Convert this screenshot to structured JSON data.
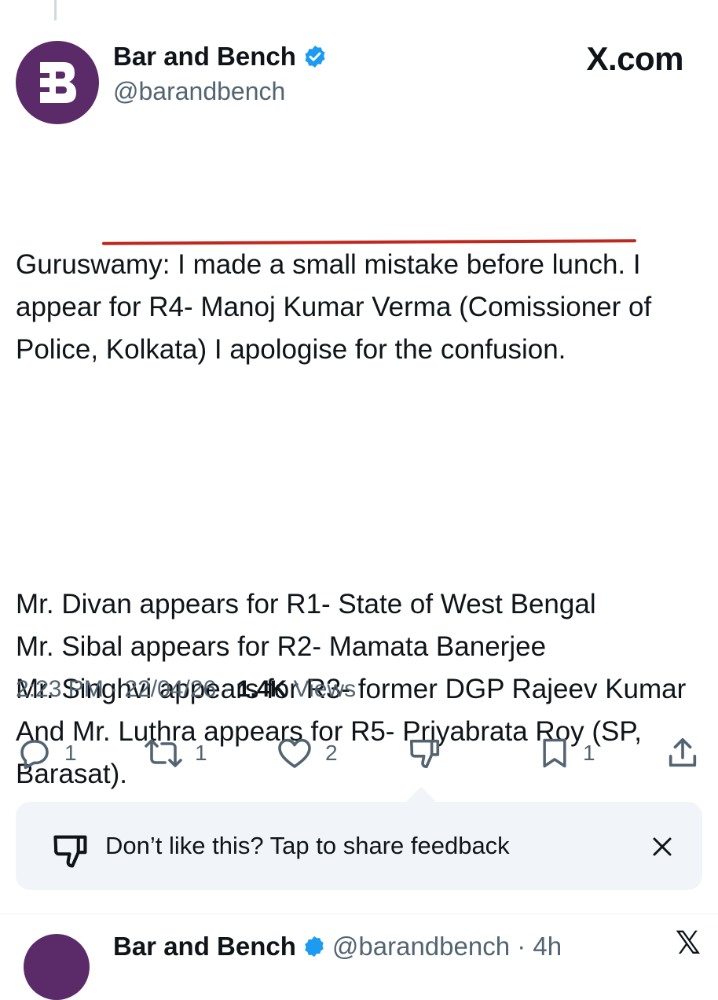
{
  "post": {
    "author_name": "Bar and Bench",
    "author_handle": "@barandbench",
    "avatar_letter": "B",
    "source_label": "X.com",
    "body_paragraphs": [
      "Guruswamy: I made a small mistake before lunch. I appear for R4- Manoj Kumar Verma (Comissioner of Police, Kolkata) I apologise for the confusion.",
      "Mr. Divan appears for R1- State of West Bengal\nMr. Sibal appears for R2- Mamata Banerjee\nMr. Singhvi appears for R3- former DGP Rajeev Kumar\nAnd Mr. Luthra appears for R5- Priyabrata Roy (SP, Barasat)."
    ],
    "time": "2:23 PM",
    "date": "22/04/26",
    "views_count": "1.4K",
    "views_label": "Views",
    "separator": "·"
  },
  "actions": {
    "reply_count": "1",
    "repost_count": "1",
    "like_count": "2",
    "bookmark_count": "1"
  },
  "feedback": {
    "text": "Don’t like this? Tap to share feedback"
  },
  "next_post": {
    "author_name": "Bar and Bench",
    "author_handle": "@barandbench · 4h"
  },
  "colors": {
    "brand_purple": "#5b2a68",
    "verified_blue": "#1d9bf0",
    "underline_red": "#c0271d",
    "secondary_text": "#536471"
  },
  "icons": [
    "verified-badge-icon",
    "reply-icon",
    "repost-icon",
    "like-icon",
    "dislike-icon",
    "bookmark-icon",
    "share-icon",
    "thumbs-down-icon",
    "close-icon",
    "x-logo-icon"
  ]
}
